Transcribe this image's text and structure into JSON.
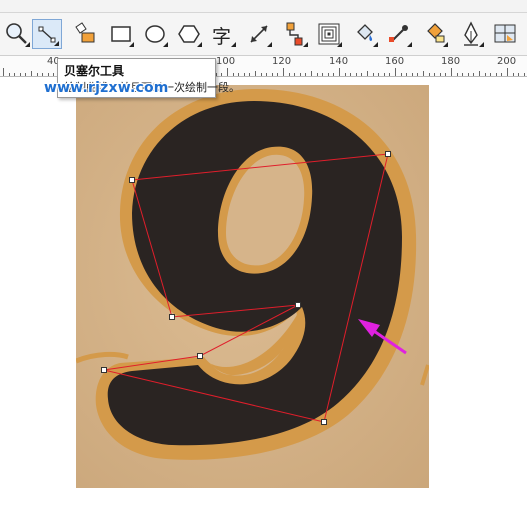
{
  "toolbar": {
    "tools": [
      {
        "name": "zoom-tool",
        "icon": "magnifier-icon",
        "active": false
      },
      {
        "name": "bezier-tool",
        "icon": "bezier-icon",
        "active": true
      },
      {
        "name": "smart-fill-tool",
        "icon": "smart-fill-icon",
        "active": false
      },
      {
        "name": "rectangle-tool",
        "icon": "rectangle-icon",
        "active": false
      },
      {
        "name": "ellipse-tool",
        "icon": "ellipse-icon",
        "active": false
      },
      {
        "name": "polygon-tool",
        "icon": "polygon-icon",
        "active": false
      },
      {
        "name": "text-tool",
        "icon": "text-icon",
        "label": "字",
        "active": false
      },
      {
        "name": "dimension-tool",
        "icon": "dimension-icon",
        "active": false
      },
      {
        "name": "connector-tool",
        "icon": "connector-icon",
        "active": false
      },
      {
        "name": "contour-tool",
        "icon": "contour-icon",
        "active": false
      },
      {
        "name": "fill-tool",
        "icon": "paint-bucket-icon",
        "active": false
      },
      {
        "name": "eyedropper-tool",
        "icon": "eyedropper-icon",
        "active": false
      },
      {
        "name": "interactive-fill-tool",
        "icon": "interactive-fill-icon",
        "active": false
      },
      {
        "name": "pen-tool",
        "icon": "pen-nib-icon",
        "active": false
      },
      {
        "name": "mesh-fill-tool",
        "icon": "mesh-fill-icon",
        "active": false
      }
    ]
  },
  "ruler": {
    "labels": [
      "40",
      "100",
      "120",
      "140",
      "160",
      "180",
      "200"
    ]
  },
  "tooltip": {
    "title": "贝塞尔工具",
    "description": "绘制曲线，并且可以一次绘制一段。"
  },
  "watermark": {
    "text": "www.rjzxw.com"
  },
  "colors": {
    "selection_line": "#e01e2b",
    "arrow": "#e021e0",
    "digit": "#2a2422",
    "paper": "#d6b48a"
  }
}
